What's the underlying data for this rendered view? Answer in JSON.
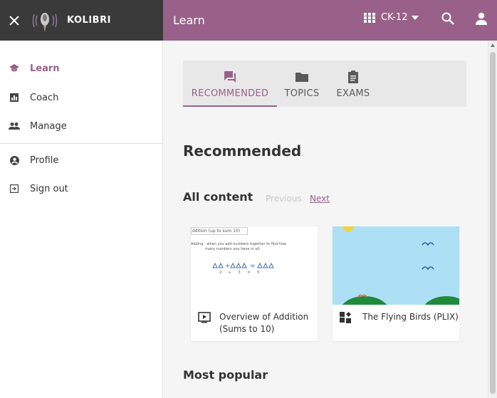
{
  "side_header": {
    "brand": "KOLIBRI"
  },
  "app_bar": {
    "title": "Learn",
    "channel": "CK-12"
  },
  "sidebar": {
    "items": [
      {
        "label": "Learn",
        "icon": "school-icon",
        "active": true
      },
      {
        "label": "Coach",
        "icon": "bar-chart-icon"
      },
      {
        "label": "Manage",
        "icon": "people-icon"
      },
      {
        "label": "Profile",
        "icon": "account-circle-icon"
      },
      {
        "label": "Sign out",
        "icon": "exit-icon"
      }
    ]
  },
  "tabs": [
    {
      "label": "RECOMMENDED",
      "icon": "forum-icon",
      "active": true
    },
    {
      "label": "TOPICS",
      "icon": "folder-icon"
    },
    {
      "label": "EXAMS",
      "icon": "assignment-icon"
    }
  ],
  "main": {
    "heading": "Recommended",
    "all_content": "All content",
    "previous": "Previous",
    "next": "Next",
    "most_popular": "Most popular"
  },
  "cards": [
    {
      "title": "Overview of Addition (Sums to 10)",
      "kind_icon": "video-icon",
      "thumb_text": {
        "header": "ddition (up to sum 10)",
        "line1": "Adding - when you add numbers together to find how",
        "line2": "many numbers you have in all:",
        "equation": "2 + 3 = 5"
      }
    },
    {
      "title": "The Flying Birds (PLIX)",
      "kind_icon": "widgets-icon"
    }
  ],
  "colors": {
    "brand": "#996189",
    "sidebar_header": "#3a3a3a"
  }
}
